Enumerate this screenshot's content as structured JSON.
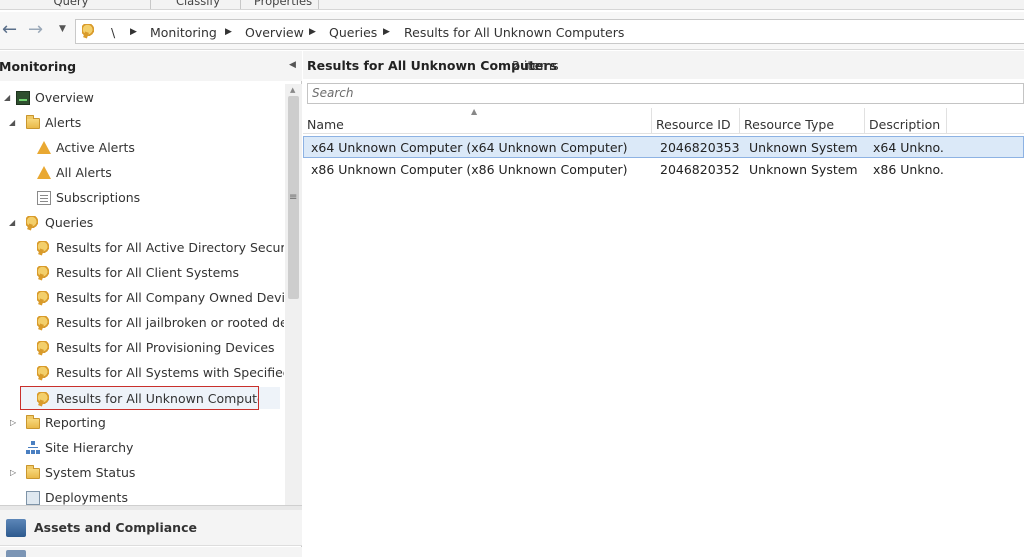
{
  "ribbon": {
    "groups": [
      "Query",
      "Classify",
      "Properties"
    ]
  },
  "breadcrumb": {
    "root": "\\",
    "items": [
      "Monitoring",
      "Overview",
      "Queries",
      "Results for All Unknown Computers"
    ]
  },
  "nav": {
    "title": "Monitoring",
    "tree": [
      {
        "label": "Overview",
        "icon": "overview-icon",
        "level": 0,
        "expanded": true
      },
      {
        "label": "Alerts",
        "icon": "folder-icon",
        "level": 1,
        "expanded": true
      },
      {
        "label": "Active Alerts",
        "icon": "alert-icon",
        "level": 2
      },
      {
        "label": "All Alerts",
        "icon": "alert-icon",
        "level": 2
      },
      {
        "label": "Subscriptions",
        "icon": "document-icon",
        "level": 2
      },
      {
        "label": "Queries",
        "icon": "query-icon",
        "level": 1,
        "expanded": true
      },
      {
        "label": "Results for All Active Directory Security G",
        "icon": "query-icon",
        "level": 2
      },
      {
        "label": "Results for All Client Systems",
        "icon": "query-icon",
        "level": 2
      },
      {
        "label": "Results for All Company Owned Devices",
        "icon": "query-icon",
        "level": 2
      },
      {
        "label": "Results for All jailbroken or rooted device",
        "icon": "query-icon",
        "level": 2
      },
      {
        "label": "Results for All Provisioning Devices",
        "icon": "query-icon",
        "level": 2
      },
      {
        "label": "Results for All Systems with Specified Sof",
        "icon": "query-icon",
        "level": 2
      },
      {
        "label": "Results for All Unknown Computers",
        "icon": "query-icon",
        "level": 2,
        "selected": true
      },
      {
        "label": "Reporting",
        "icon": "folder-icon",
        "level": 1,
        "expanded": false
      },
      {
        "label": "Site Hierarchy",
        "icon": "hierarchy-icon",
        "level": 1
      },
      {
        "label": "System Status",
        "icon": "folder-icon",
        "level": 1,
        "expanded": false
      },
      {
        "label": "Deployments",
        "icon": "deployment-icon",
        "level": 1
      }
    ],
    "workspace": "Assets and Compliance"
  },
  "results": {
    "title": "Results for All Unknown Computers",
    "count": "2 items",
    "search_placeholder": "Search",
    "columns": [
      "Name",
      "Resource ID",
      "Resource Type",
      "Description"
    ],
    "rows": [
      {
        "name": "x64 Unknown Computer (x64 Unknown Computer)",
        "resource_id": "2046820353",
        "resource_type": "Unknown System",
        "description": "x64 Unkno...",
        "selected": true
      },
      {
        "name": "x86 Unknown Computer (x86 Unknown Computer)",
        "resource_id": "2046820352",
        "resource_type": "Unknown System",
        "description": "x86 Unkno...",
        "selected": false
      }
    ]
  },
  "colors": {
    "selection_fill": "#dbe9f8",
    "selection_border": "#8db2e3",
    "highlight_box": "#c9302c"
  }
}
